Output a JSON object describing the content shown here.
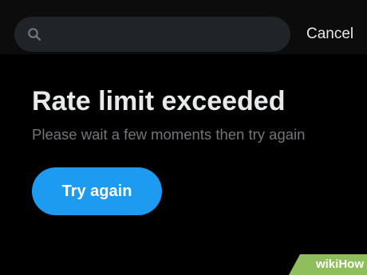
{
  "header": {
    "search": {
      "placeholder": "",
      "value": "",
      "icon": "search-icon"
    },
    "cancel_label": "Cancel"
  },
  "error": {
    "title": "Rate limit exceeded",
    "message": "Please wait a few moments then try again",
    "button_label": "Try again"
  },
  "watermark": {
    "part1": "wiki",
    "part2": "How"
  },
  "colors": {
    "background": "#000000",
    "topbar": "#0c0c0c",
    "search_box": "#202327",
    "primary_text": "#e7e9ea",
    "secondary_text": "#71767b",
    "accent": "#1d9bf0",
    "watermark_bg": "#8fbe5c"
  }
}
